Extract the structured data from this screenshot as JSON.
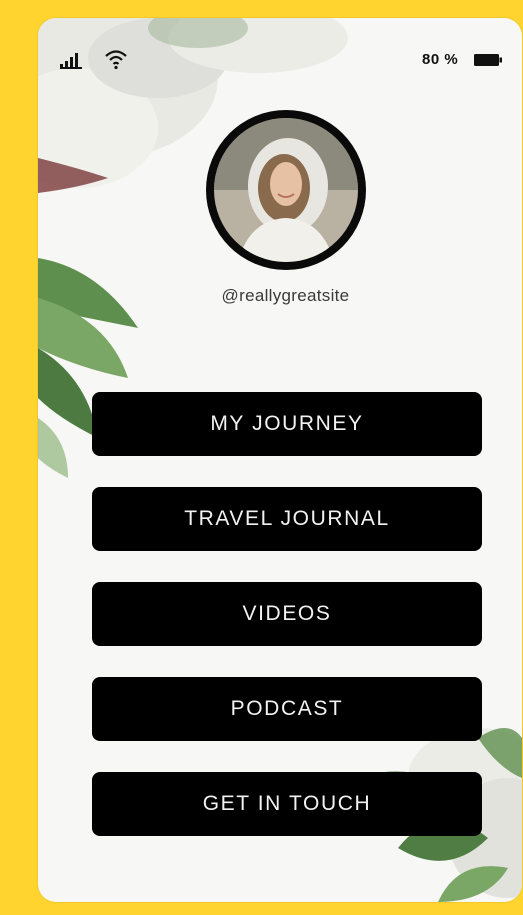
{
  "status_bar": {
    "signal_icon": "signal-bars-icon",
    "wifi_icon": "wifi-icon",
    "battery_percent": "80 %",
    "battery_icon": "battery-icon"
  },
  "profile": {
    "avatar_icon": "profile-photo",
    "handle": "@reallygreatsite"
  },
  "links": [
    {
      "label": "MY JOURNEY"
    },
    {
      "label": "TRAVEL JOURNAL"
    },
    {
      "label": "VIDEOS"
    },
    {
      "label": "PODCAST"
    },
    {
      "label": "GET IN TOUCH"
    }
  ],
  "colors": {
    "background": "#ffd42e",
    "screen": "#f7f7f5",
    "button": "#000000",
    "button_text": "#f2f2f2"
  }
}
